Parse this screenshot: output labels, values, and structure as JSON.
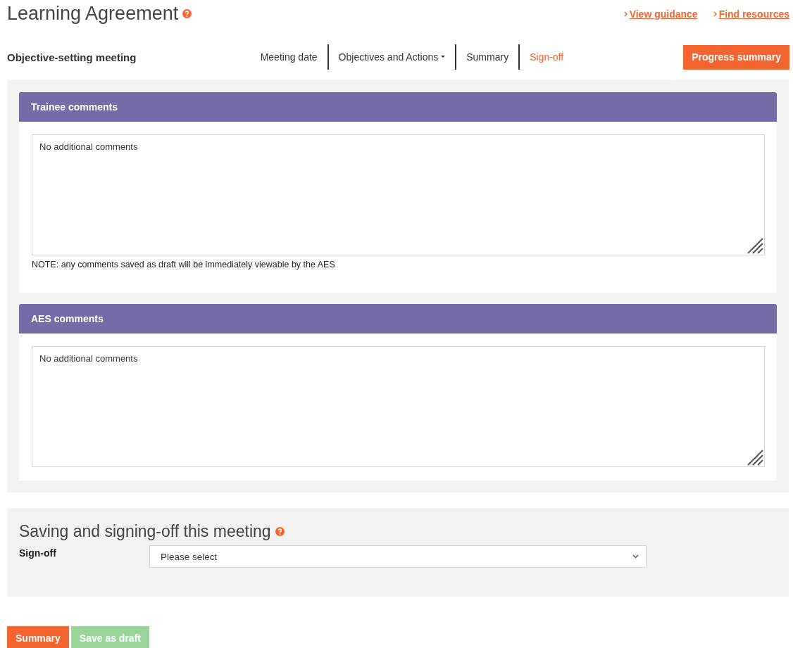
{
  "header": {
    "title": "Learning Agreement",
    "links": [
      "View guidance",
      "Find resources"
    ]
  },
  "nav": {
    "heading": "Objective-setting meeting",
    "tabs": [
      {
        "label": "Meeting date",
        "kind": "plain",
        "selected": false
      },
      {
        "label": "Objectives and Actions",
        "kind": "dropdown",
        "selected": false
      },
      {
        "label": "Summary",
        "kind": "plain",
        "selected": false
      },
      {
        "label": "Sign-off",
        "kind": "plain",
        "selected": true
      }
    ],
    "button": "Progress summary"
  },
  "panels": [
    {
      "title": "Trainee comments",
      "value": "No additional comments",
      "note": "NOTE: any comments saved as draft will be immediately viewable by the AES"
    },
    {
      "title": "AES comments",
      "value": "No additional comments"
    }
  ],
  "signoff": {
    "title": "Saving and signing-off this meeting",
    "label": "Sign-off",
    "value": "Please select"
  },
  "buttons": [
    {
      "label": "Summary",
      "disabled": false
    },
    {
      "label": "Save as draft",
      "disabled": true
    }
  ]
}
